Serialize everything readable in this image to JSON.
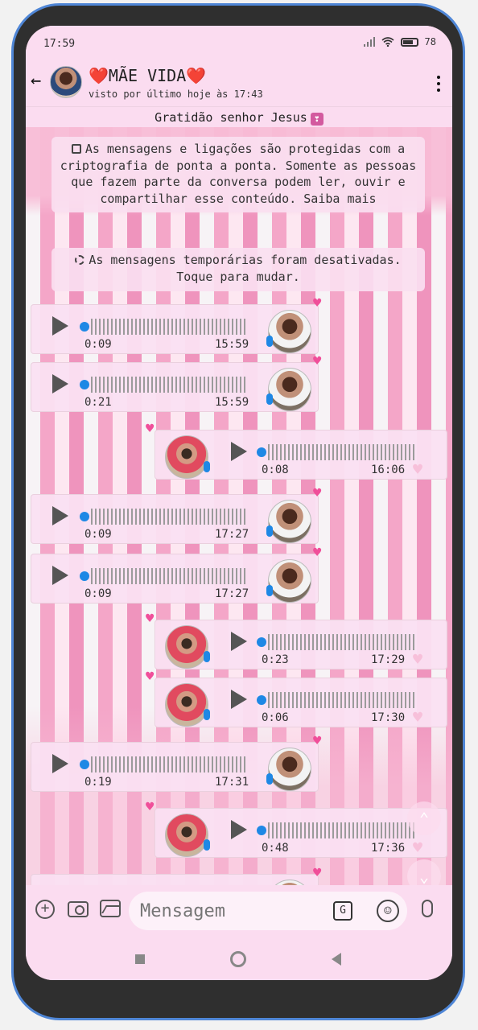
{
  "status_bar": {
    "time": "17:59",
    "battery": "78"
  },
  "header": {
    "contact_name": "❤️MÃE VIDA❤️",
    "last_seen": "visto por último hoje às 17:43"
  },
  "pinned": {
    "text": "Gratidão senhor Jesus"
  },
  "notices": {
    "encryption": "As mensagens e ligações são protegidas com a criptografia de ponta a ponta. Somente as pessoas que fazem parte da conversa podem ler, ouvir e compartilhar esse conteúdo. Saiba mais",
    "temporary": "As mensagens temporárias foram desativadas. Toque para mudar."
  },
  "messages": [
    {
      "duration": "0:09",
      "time": "15:59",
      "side": "left"
    },
    {
      "duration": "0:21",
      "time": "15:59",
      "side": "left"
    },
    {
      "duration": "0:08",
      "time": "16:06",
      "side": "right"
    },
    {
      "duration": "0:09",
      "time": "17:27",
      "side": "left"
    },
    {
      "duration": "0:09",
      "time": "17:27",
      "side": "left"
    },
    {
      "duration": "0:23",
      "time": "17:29",
      "side": "right"
    },
    {
      "duration": "0:06",
      "time": "17:30",
      "side": "right"
    },
    {
      "duration": "0:19",
      "time": "17:31",
      "side": "left"
    },
    {
      "duration": "0:48",
      "time": "17:36",
      "side": "right"
    },
    {
      "duration": "",
      "time": "",
      "side": "left"
    }
  ],
  "input": {
    "placeholder": "Mensagem"
  },
  "colors": {
    "accent": "#1e88e5",
    "heart": "#f04f9a",
    "theme_pink": "#fbdcf0"
  },
  "icons": {
    "back": "arrow-left-icon",
    "menu": "more-vertical-icon",
    "add": "plus-circle-icon",
    "camera": "camera-icon",
    "gallery": "image-icon",
    "translate": "translate-icon",
    "emoji": "emoji-icon",
    "voice": "microphone-icon"
  }
}
